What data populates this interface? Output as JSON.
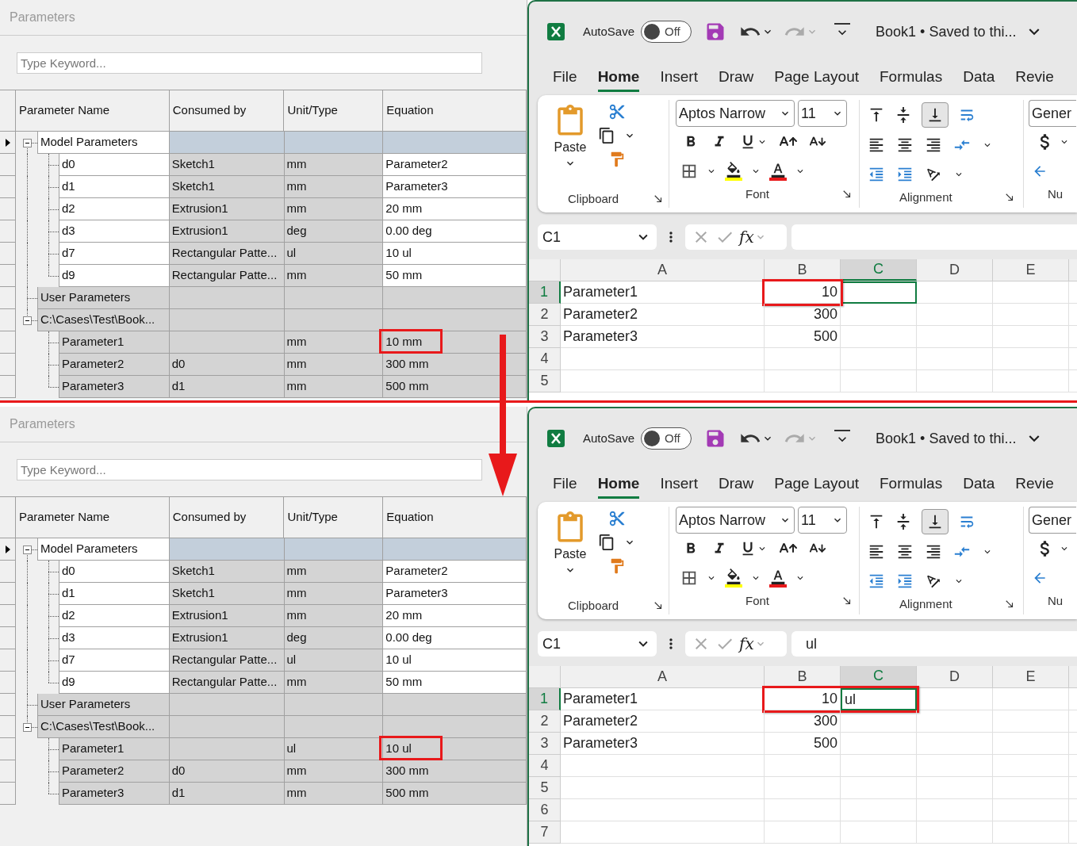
{
  "panels": [
    {
      "parameters": {
        "title": "Parameters",
        "search": {
          "placeholder": "Type Keyword..."
        },
        "columns": [
          "Parameter Name",
          "Consumed by",
          "Unit/Type",
          "Equation"
        ],
        "tree": [
          {
            "kind": "group",
            "name": "Model Parameters",
            "selected": true,
            "expanded": true,
            "children": [
              {
                "kind": "model",
                "name": "d0",
                "consumed_by": "Sketch1",
                "unit": "mm",
                "equation": "Parameter2",
                "selected": false
              },
              {
                "kind": "model",
                "name": "d1",
                "consumed_by": "Sketch1",
                "unit": "mm",
                "equation": "Parameter3",
                "selected": false
              },
              {
                "kind": "model",
                "name": "d2",
                "consumed_by": "Extrusion1",
                "unit": "mm",
                "equation": "20 mm",
                "selected": false
              },
              {
                "kind": "model",
                "name": "d3",
                "consumed_by": "Extrusion1",
                "unit": "deg",
                "equation": "0.00 deg",
                "selected": false
              },
              {
                "kind": "model",
                "name": "d7",
                "consumed_by": "Rectangular Patte...",
                "unit": "ul",
                "equation": "10 ul",
                "selected": false
              },
              {
                "kind": "model",
                "name": "d9",
                "consumed_by": "Rectangular Patte...",
                "unit": "mm",
                "equation": "50 mm",
                "selected": false
              }
            ]
          },
          {
            "kind": "group",
            "name": "User Parameters",
            "selected": false
          },
          {
            "kind": "group",
            "name": "C:\\Cases\\Test\\Book...",
            "selected": false,
            "expanded": true,
            "children": [
              {
                "kind": "user",
                "name": "Parameter1",
                "unit": "mm",
                "equation": "10 mm",
                "selected": false,
                "highlighted": true
              },
              {
                "kind": "user",
                "name": "Parameter2",
                "consumed_by": "d0",
                "unit": "mm",
                "equation": "300 mm",
                "selected": false,
                "highlighted": false
              },
              {
                "kind": "user",
                "name": "Parameter3",
                "consumed_by": "d1",
                "unit": "mm",
                "equation": "500 mm",
                "selected": false,
                "highlighted": false
              }
            ]
          }
        ]
      },
      "excel": {
        "autosave": {
          "label": "AutoSave",
          "on": false,
          "state_label": "Off"
        },
        "title": "Book1 • Saved to thi...",
        "tabs": [
          {
            "label": "File",
            "selected": false
          },
          {
            "label": "Home",
            "selected": true
          },
          {
            "label": "Insert",
            "selected": false
          },
          {
            "label": "Draw",
            "selected": false
          },
          {
            "label": "Page Layout",
            "selected": false
          },
          {
            "label": "Formulas",
            "selected": false
          },
          {
            "label": "Data",
            "selected": false
          },
          {
            "label": "Revie",
            "selected": false
          }
        ],
        "ribbon": {
          "paste_label": "Paste",
          "font_name": "Aptos Narrow",
          "font_size": "11",
          "number_format": "Gener",
          "groups": [
            "Clipboard",
            "Font",
            "Alignment",
            "Nu"
          ]
        },
        "formula_bar": {
          "name_box": "C1",
          "function_label": "fx"
        },
        "sheet": {
          "columns": [
            {
              "label": "A",
              "selected": false
            },
            {
              "label": "B",
              "selected": false
            },
            {
              "label": "C",
              "selected": true
            },
            {
              "label": "D",
              "selected": false
            },
            {
              "label": "E",
              "selected": false
            }
          ],
          "rows": [
            {
              "number": "1",
              "selected": true,
              "cells": [
                {
                  "text": "Parameter1",
                  "kind": "text",
                  "highlighted": false
                },
                {
                  "text": "10",
                  "kind": "number",
                  "highlighted": true
                }
              ]
            },
            {
              "number": "2",
              "selected": false,
              "cells": [
                {
                  "text": "Parameter2",
                  "kind": "text",
                  "highlighted": false
                },
                {
                  "text": "300",
                  "kind": "number",
                  "highlighted": false
                }
              ]
            },
            {
              "number": "3",
              "selected": false,
              "cells": [
                {
                  "text": "Parameter3",
                  "kind": "text",
                  "highlighted": false
                },
                {
                  "text": "500",
                  "kind": "number",
                  "highlighted": false
                }
              ]
            },
            {
              "number": "4",
              "selected": false
            },
            {
              "number": "5",
              "selected": false
            }
          ]
        }
      }
    },
    {
      "parameters": {
        "title": "Parameters",
        "search": {
          "placeholder": "Type Keyword..."
        },
        "columns": [
          "Parameter Name",
          "Consumed by",
          "Unit/Type",
          "Equation"
        ],
        "tree": [
          {
            "kind": "group",
            "name": "Model Parameters",
            "selected": true,
            "expanded": true,
            "children": [
              {
                "kind": "model",
                "name": "d0",
                "consumed_by": "Sketch1",
                "unit": "mm",
                "equation": "Parameter2",
                "selected": false
              },
              {
                "kind": "model",
                "name": "d1",
                "consumed_by": "Sketch1",
                "unit": "mm",
                "equation": "Parameter3",
                "selected": false
              },
              {
                "kind": "model",
                "name": "d2",
                "consumed_by": "Extrusion1",
                "unit": "mm",
                "equation": "20 mm",
                "selected": false
              },
              {
                "kind": "model",
                "name": "d3",
                "consumed_by": "Extrusion1",
                "unit": "deg",
                "equation": "0.00 deg",
                "selected": false
              },
              {
                "kind": "model",
                "name": "d7",
                "consumed_by": "Rectangular Patte...",
                "unit": "ul",
                "equation": "10 ul",
                "selected": false
              },
              {
                "kind": "model",
                "name": "d9",
                "consumed_by": "Rectangular Patte...",
                "unit": "mm",
                "equation": "50 mm",
                "selected": false
              }
            ]
          },
          {
            "kind": "group",
            "name": "User Parameters",
            "selected": false
          },
          {
            "kind": "group",
            "name": "C:\\Cases\\Test\\Book...",
            "selected": false,
            "expanded": true,
            "children": [
              {
                "kind": "user",
                "name": "Parameter1",
                "unit": "ul",
                "equation": "10 ul",
                "selected": false,
                "highlighted": true
              },
              {
                "kind": "user",
                "name": "Parameter2",
                "consumed_by": "d0",
                "unit": "mm",
                "equation": "300 mm",
                "selected": false,
                "highlighted": false
              },
              {
                "kind": "user",
                "name": "Parameter3",
                "consumed_by": "d1",
                "unit": "mm",
                "equation": "500 mm",
                "selected": false,
                "highlighted": false
              }
            ]
          }
        ]
      },
      "excel": {
        "autosave": {
          "label": "AutoSave",
          "on": false,
          "state_label": "Off"
        },
        "title": "Book1 • Saved to thi...",
        "tabs": [
          {
            "label": "File",
            "selected": false
          },
          {
            "label": "Home",
            "selected": true
          },
          {
            "label": "Insert",
            "selected": false
          },
          {
            "label": "Draw",
            "selected": false
          },
          {
            "label": "Page Layout",
            "selected": false
          },
          {
            "label": "Formulas",
            "selected": false
          },
          {
            "label": "Data",
            "selected": false
          },
          {
            "label": "Revie",
            "selected": false
          }
        ],
        "ribbon": {
          "paste_label": "Paste",
          "font_name": "Aptos Narrow",
          "font_size": "11",
          "number_format": "Gener",
          "groups": [
            "Clipboard",
            "Font",
            "Alignment",
            "Nu"
          ]
        },
        "formula_bar": {
          "name_box": "C1",
          "function_label": "fx",
          "value": "ul"
        },
        "sheet": {
          "columns": [
            {
              "label": "A",
              "selected": false
            },
            {
              "label": "B",
              "selected": false
            },
            {
              "label": "C",
              "selected": true
            },
            {
              "label": "D",
              "selected": false
            },
            {
              "label": "E",
              "selected": false
            }
          ],
          "rows": [
            {
              "number": "1",
              "selected": true,
              "cells": [
                {
                  "text": "Parameter1",
                  "kind": "text",
                  "highlighted": false
                },
                {
                  "text": "10",
                  "kind": "number",
                  "highlighted": true
                },
                {
                  "text": "ul",
                  "kind": "text",
                  "highlighted": true
                }
              ]
            },
            {
              "number": "2",
              "selected": false,
              "cells": [
                {
                  "text": "Parameter2",
                  "kind": "text",
                  "highlighted": false
                },
                {
                  "text": "300",
                  "kind": "number",
                  "highlighted": false
                }
              ]
            },
            {
              "number": "3",
              "selected": false,
              "cells": [
                {
                  "text": "Parameter3",
                  "kind": "text",
                  "highlighted": false
                },
                {
                  "text": "500",
                  "kind": "number",
                  "highlighted": false
                }
              ]
            },
            {
              "number": "4",
              "selected": false
            },
            {
              "number": "5",
              "selected": false
            },
            {
              "number": "6",
              "selected": false
            },
            {
              "number": "7",
              "selected": false
            }
          ]
        }
      }
    }
  ]
}
